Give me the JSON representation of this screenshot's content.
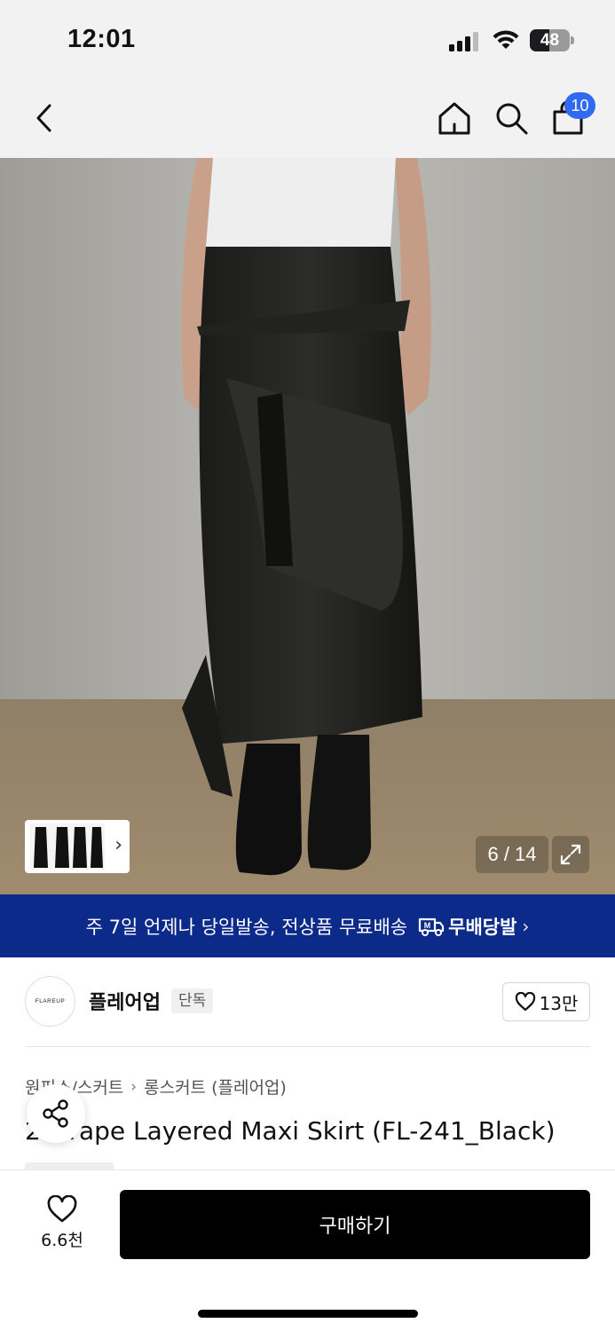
{
  "status_bar": {
    "time": "12:01",
    "battery_level": "48",
    "battery_fraction": 0.48
  },
  "nav": {
    "back_icon": "chevron-left-icon",
    "home_icon": "home-icon",
    "search_icon": "search-icon",
    "cart_icon": "cart-icon",
    "cart_count": "10",
    "accent_color": "#2f6af0"
  },
  "gallery": {
    "page_counter": "6 / 14",
    "thumb_arrow": "›",
    "expand_icon": "expand-icon"
  },
  "promo": {
    "text": "주 7일 언제나 당일발송, 전상품 무료배송",
    "badge_label": "무배당발",
    "arrow": "›",
    "background_color": "#0b2a8a"
  },
  "brand": {
    "logo_text": "FLAREUP",
    "name": "플레어업",
    "tag": "단독",
    "like_count": "13만"
  },
  "breadcrumb": {
    "items": [
      "원피스/스커트",
      "롱스커트 (플레어업)"
    ],
    "separator": "›"
  },
  "product": {
    "title": "2-Drape Layered Maxi Skirt (FL-241_Black)"
  },
  "bottom_bar": {
    "wish_count": "6.6천",
    "buy_label": "구매하기"
  }
}
